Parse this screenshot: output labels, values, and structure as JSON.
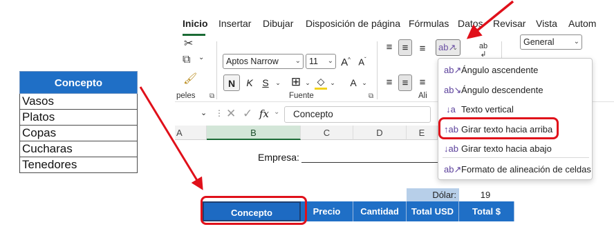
{
  "left_table": {
    "header": "Concepto",
    "rows": [
      "Vasos",
      "Platos",
      "Copas",
      "Cucharas",
      "Tenedores"
    ]
  },
  "tabs": [
    "Inicio",
    "Insertar",
    "Dibujar",
    "Disposición de página",
    "Fórmulas",
    "Datos",
    "Revisar",
    "Vista",
    "Autom"
  ],
  "ribbon": {
    "font_name": "Aptos Narrow",
    "font_size": "11",
    "grow_font": "A",
    "shrink_font": "A",
    "bold": "N",
    "italic": "K",
    "underline": "S",
    "font_color_letter": "A",
    "number_format": "General",
    "group_clipboard": "peles",
    "group_font": "Fuente",
    "group_alignment": "Ali",
    "wrap_icon_text": "ab"
  },
  "formula_bar": {
    "fx": "fx",
    "value": "Concepto"
  },
  "columns": [
    "A",
    "B",
    "C",
    "D",
    "E"
  ],
  "sheet": {
    "empresa_label": "Empresa:",
    "dolar_label": "Dólar:",
    "dolar_value": "19",
    "headers": [
      "Concepto",
      "Precio",
      "Cantidad",
      "Total USD",
      "Total $"
    ]
  },
  "orientation_menu": {
    "items": [
      {
        "label": "Ángulo ascendente",
        "icon": "angle-counterclockwise-icon"
      },
      {
        "label": "Ángulo descendente",
        "icon": "angle-clockwise-icon"
      },
      {
        "label": "Texto vertical",
        "icon": "vertical-text-icon"
      },
      {
        "label": "Girar texto hacia arriba",
        "icon": "rotate-text-up-icon"
      },
      {
        "label": "Girar texto hacia abajo",
        "icon": "rotate-text-down-icon"
      },
      {
        "label": "Formato de alineación de celdas",
        "icon": "format-alignment-icon"
      }
    ]
  },
  "colors": {
    "header_blue": "#1f6fc6",
    "highlight_red": "#e0101a",
    "dolar_fill": "#b7cfe9",
    "excel_green": "#1b6b35"
  }
}
